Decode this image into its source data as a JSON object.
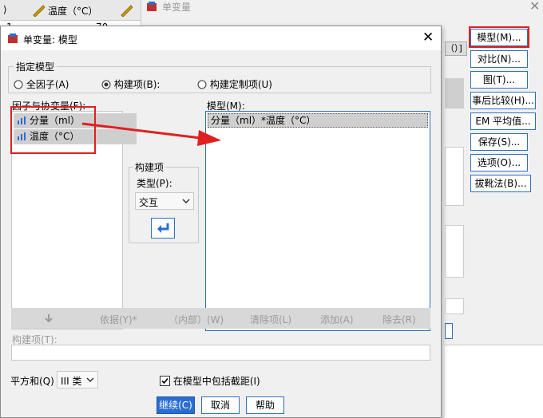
{
  "background": {
    "data_header": [
      "",
      "温度（°C）"
    ],
    "data_cell": "70",
    "data_row": "1",
    "outer_title": "单变量",
    "outer_field_tail": "（）]",
    "outer_buttons": [
      "模型(M)...",
      "对比(N)...",
      "图(T)...",
      "事后比较(H)...",
      "EM 平均值...",
      "保存(S)...",
      "选项(O)...",
      "拔靴法(B)..."
    ]
  },
  "dialog": {
    "title": "单变量: 模型",
    "group_label": "指定模型",
    "radios": [
      {
        "label": "全因子(A)",
        "checked": false
      },
      {
        "label": "构建项(B):",
        "checked": true
      },
      {
        "label": "构建定制项(U)",
        "checked": false
      }
    ],
    "factors_label": "因子与协变量(F):",
    "factors": [
      "分量（ml）",
      "温度（°C）"
    ],
    "model_label": "模型(M):",
    "model_items": [
      "分量（ml）*温度（°C）"
    ],
    "build_term": {
      "group_label": "构建项",
      "type_label": "类型(P):",
      "type_value": "交互"
    },
    "toolbar": [
      "依据(Y)*",
      "（内部）(W)",
      "清除项(L)",
      "添加(A)",
      "除去(R)"
    ],
    "term_label": "构建项(T):",
    "term_value": "",
    "sum_squares_label": "平方和(Q)",
    "sum_squares_value": "III 类",
    "include_intercept_label": "在模型中包括截距(I)",
    "include_intercept_checked": true,
    "buttons": {
      "continue": "继续(C)",
      "cancel": "取消",
      "help": "帮助"
    }
  },
  "colors": {
    "accent": "#2a6dd2",
    "highlight": "#e02020",
    "selection": "#cfcfcf"
  }
}
